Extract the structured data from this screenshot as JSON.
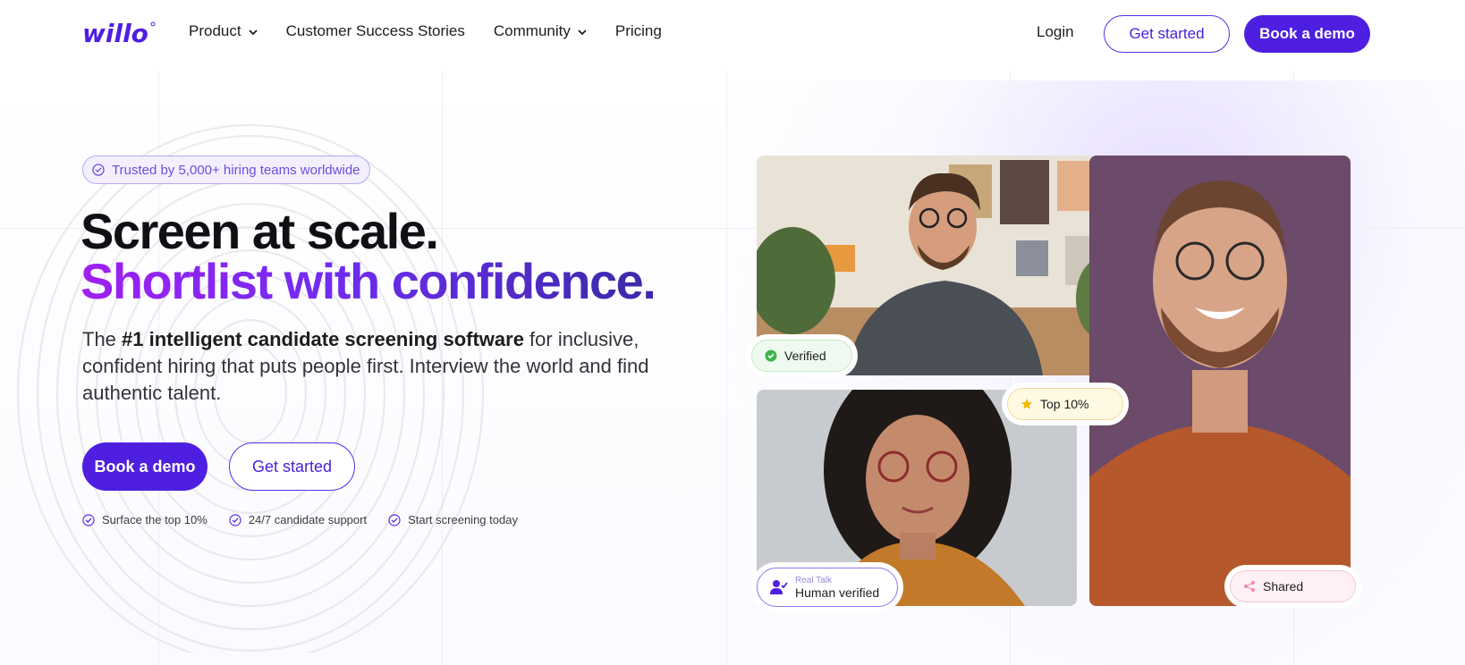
{
  "nav": {
    "logo_text": "willo",
    "items": [
      {
        "label": "Product",
        "has_dropdown": true
      },
      {
        "label": "Customer Success Stories",
        "has_dropdown": false
      },
      {
        "label": "Community",
        "has_dropdown": true
      },
      {
        "label": "Pricing",
        "has_dropdown": false
      }
    ],
    "login_label": "Login",
    "get_started_label": "Get started",
    "book_demo_label": "Book a demo"
  },
  "hero": {
    "trust_badge": "Trusted by 5,000+ hiring teams worldwide",
    "headline_line1": "Screen at scale.",
    "headline_line2": "Shortlist with confidence.",
    "subtext_prefix": "The ",
    "subtext_bold": "#1 intelligent candidate screening software",
    "subtext_suffix": " for inclusive, confident hiring that puts people first. Interview the world and find authentic talent.",
    "cta_primary": "Book a demo",
    "cta_secondary": "Get started",
    "features": [
      {
        "label": "Surface the top 10%",
        "icon": "check-circle-icon"
      },
      {
        "label": "24/7 candidate support",
        "icon": "check-circle-icon"
      },
      {
        "label": "Start screening today",
        "icon": "check-circle-icon"
      }
    ]
  },
  "collage": {
    "badge_verified": "Verified",
    "badge_top": "Top 10%",
    "badge_human_small": "Real Talk",
    "badge_human_big": "Human verified",
    "badge_shared": "Shared"
  },
  "colors": {
    "brand_primary": "#4e1fe0",
    "gradient_start": "#a020f0",
    "gradient_end": "#3a2aa8",
    "verified_green": "#3bb54a",
    "top_star": "#f2b705",
    "shared_pink": "#f08aa8"
  }
}
